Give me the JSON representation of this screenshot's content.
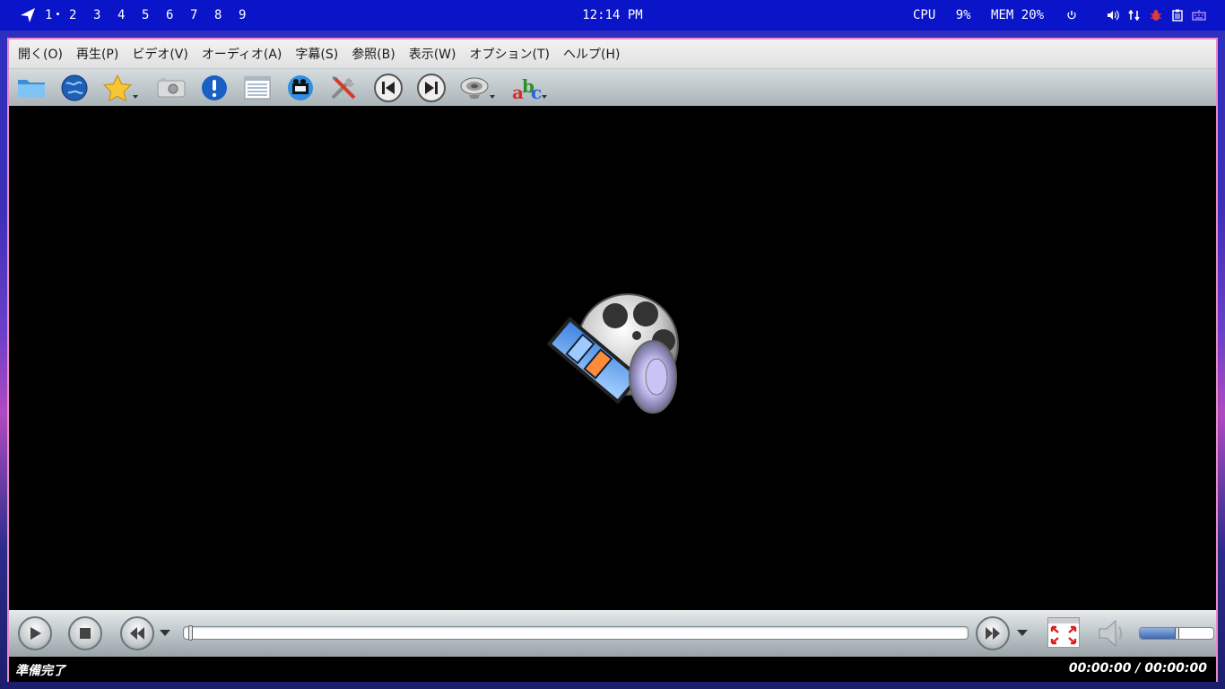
{
  "panel": {
    "workspaces": [
      "1",
      "2",
      "3",
      "4",
      "5",
      "6",
      "7",
      "8",
      "9"
    ],
    "active_workspace": "1",
    "clock": "12:14 PM",
    "cpu_label": "CPU",
    "cpu_value": "9%",
    "mem_label": "MEM",
    "mem_value": "20%",
    "tray_icons": [
      "power-icon",
      "volume-icon",
      "network-icon",
      "bug-icon",
      "clipboard-icon",
      "keyboard-icon"
    ]
  },
  "menu": {
    "open": "開く(O)",
    "play": "再生(P)",
    "video": "ビデオ(V)",
    "audio": "オーディオ(A)",
    "subtitles": "字幕(S)",
    "browse": "参照(B)",
    "view": "表示(W)",
    "options": "オプション(T)",
    "help": "ヘルプ(H)"
  },
  "toolbar_icons": [
    "folder-icon",
    "globe-icon",
    "favorites-star-icon",
    "screenshot-camera-icon",
    "info-icon",
    "playlist-icon",
    "video-equalizer-icon",
    "preferences-tools-icon",
    "previous-icon",
    "next-icon",
    "audio-track-icon",
    "subtitle-abc-icon"
  ],
  "accent_colors": {
    "panel": "#0a14c8",
    "window_border": "#e88ac6",
    "seek_fill": "#6f93c7"
  },
  "player": {
    "progress": 0,
    "volume_fraction": 0.5
  },
  "status": {
    "text": "準備完了",
    "time": "00:00:00 / 00:00:00"
  }
}
